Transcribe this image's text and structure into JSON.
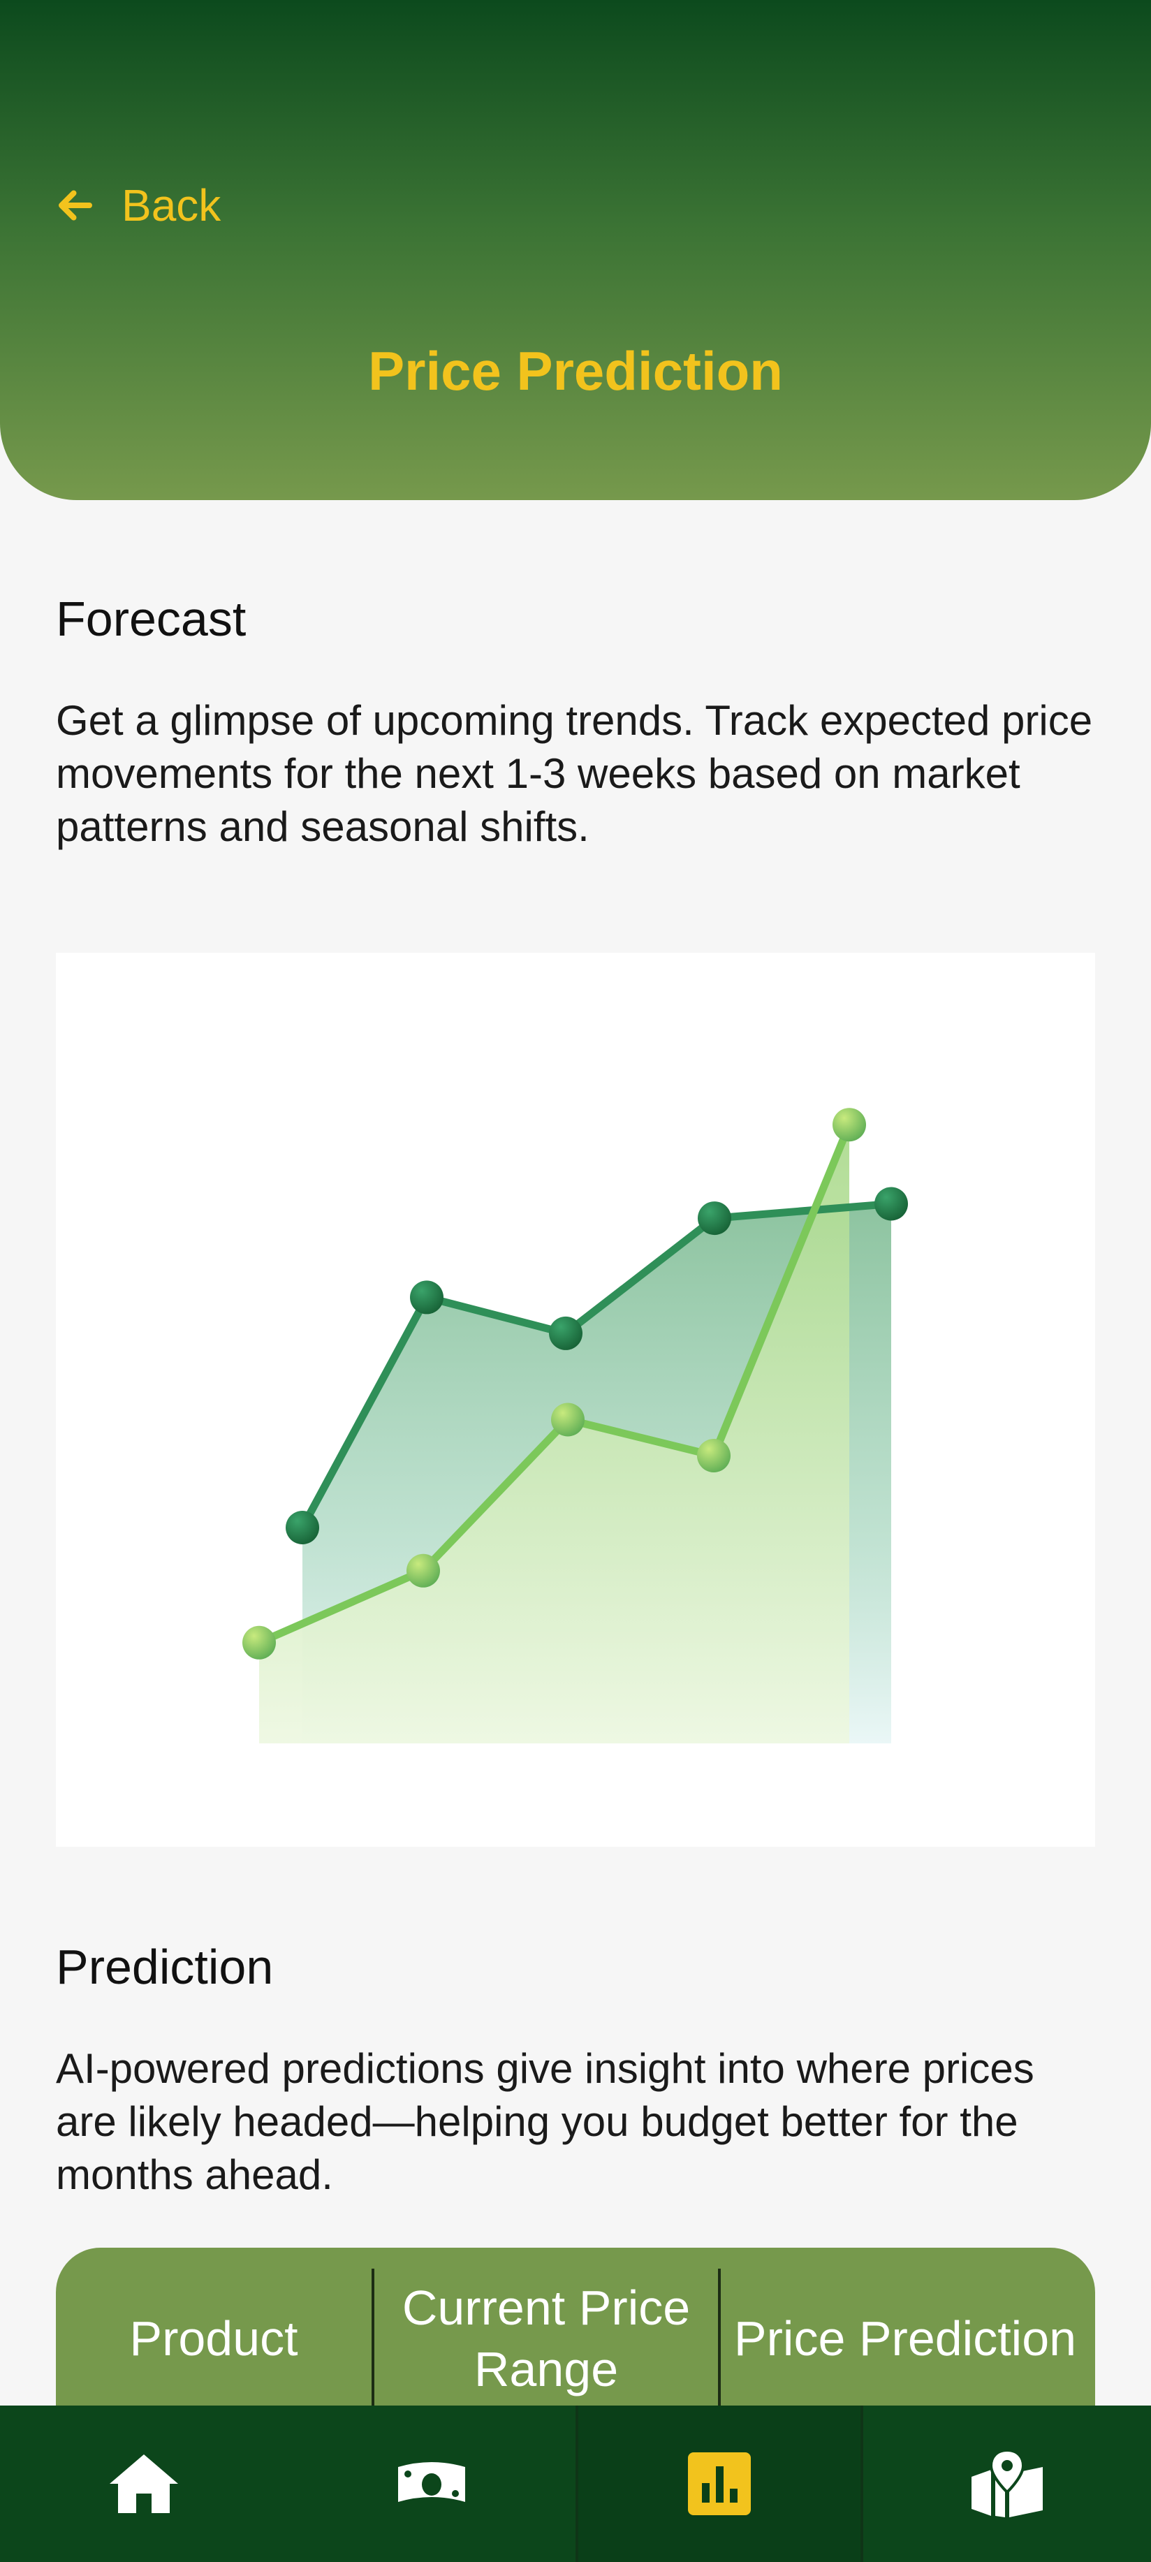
{
  "header": {
    "back_label": "Back",
    "title": "Price Prediction"
  },
  "forecast": {
    "heading": "Forecast",
    "description": "Get a glimpse of upcoming trends. Track expected price movements for the next 1-3 weeks based on market patterns and seasonal shifts."
  },
  "prediction": {
    "heading": "Prediction",
    "description": "AI-powered predictions give insight into where prices are likely headed—helping you budget better for the months ahead."
  },
  "table": {
    "columns": [
      "Product",
      "Current Price Range",
      "Price Prediction"
    ]
  },
  "nav": {
    "items": [
      {
        "icon": "home-icon"
      },
      {
        "icon": "money-icon"
      },
      {
        "icon": "bar-chart-icon",
        "active": true
      },
      {
        "icon": "map-icon"
      }
    ]
  },
  "colors": {
    "header_dark": "#0c4a1d",
    "header_light": "#76994c",
    "accent_yellow": "#f2c31d",
    "nav_background": "#0c461b",
    "table_header": "#76994c",
    "series_dark": "#2f8f58",
    "series_light": "#7cc85a"
  },
  "chart_data": {
    "type": "line",
    "x": [
      1,
      2,
      3,
      4,
      5,
      6
    ],
    "series": [
      {
        "values": [
          30,
          62,
          57,
          73,
          75
        ]
      },
      {
        "values": [
          14,
          24,
          45,
          40,
          86
        ]
      }
    ],
    "xlim": [
      0,
      6
    ],
    "ylim": [
      0,
      100
    ],
    "grid": false
  }
}
